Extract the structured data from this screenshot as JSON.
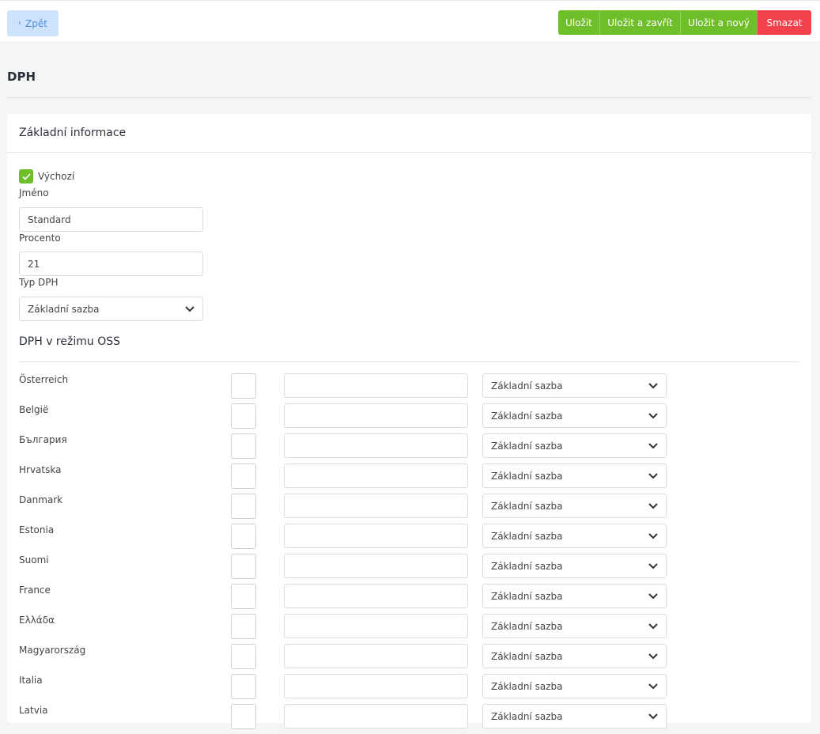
{
  "toolbar": {
    "back_label": "Zpět",
    "save_label": "Uložit",
    "save_close_label": "Uložit a zavřít",
    "save_new_label": "Uložit a nový",
    "delete_label": "Smazat",
    "save_color": "#6fbf2a",
    "delete_color": "#f4424d",
    "back_bg_color": "#cfe2fb"
  },
  "page": {
    "title": "DPH"
  },
  "basic": {
    "title": "Základní informace",
    "default_label": "Výchozí",
    "default_checked": true,
    "name_label": "Jméno",
    "name_value": "Standard",
    "percent_label": "Procento",
    "percent_value": "21",
    "type_label": "Typ DPH",
    "type_value": "Základní sazba"
  },
  "oss": {
    "title": "DPH v režimu OSS",
    "rows": [
      {
        "country": "Österreich",
        "rate": "Základní sazba"
      },
      {
        "country": "België",
        "rate": "Základní sazba"
      },
      {
        "country": "България",
        "rate": "Základní sazba"
      },
      {
        "country": "Hrvatska",
        "rate": "Základní sazba"
      },
      {
        "country": "Danmark",
        "rate": "Základní sazba"
      },
      {
        "country": "Estonia",
        "rate": "Základní sazba"
      },
      {
        "country": "Suomi",
        "rate": "Základní sazba"
      },
      {
        "country": "France",
        "rate": "Základní sazba"
      },
      {
        "country": "Ελλάδα",
        "rate": "Základní sazba"
      },
      {
        "country": "Magyarország",
        "rate": "Základní sazba"
      },
      {
        "country": "Italia",
        "rate": "Základní sazba"
      },
      {
        "country": "Latvia",
        "rate": "Základní sazba"
      }
    ]
  }
}
